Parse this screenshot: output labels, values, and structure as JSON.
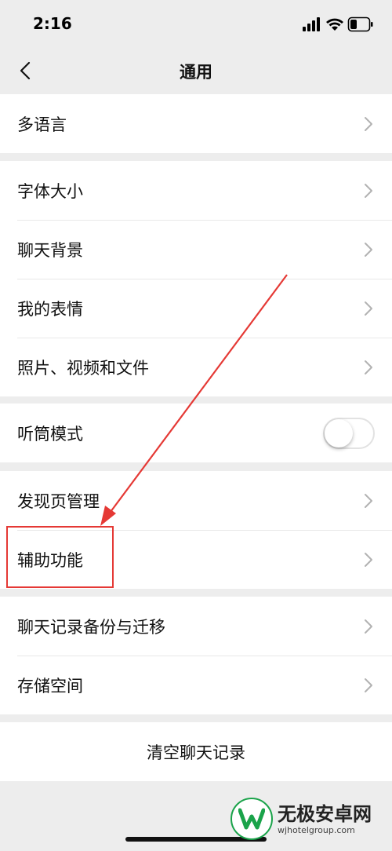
{
  "status_bar": {
    "time": "2:16",
    "icons": [
      "signal-icon",
      "wifi-icon",
      "battery-icon"
    ]
  },
  "nav": {
    "back_icon": "chevron-left-icon",
    "title": "通用"
  },
  "groups": [
    {
      "items": [
        {
          "label": "多语言",
          "accessory": "chevron"
        }
      ]
    },
    {
      "items": [
        {
          "label": "字体大小",
          "accessory": "chevron"
        },
        {
          "label": "聊天背景",
          "accessory": "chevron"
        },
        {
          "label": "我的表情",
          "accessory": "chevron"
        },
        {
          "label": "照片、视频和文件",
          "accessory": "chevron"
        }
      ]
    },
    {
      "items": [
        {
          "label": "听筒模式",
          "accessory": "toggle",
          "toggle_on": false
        }
      ]
    },
    {
      "items": [
        {
          "label": "发现页管理",
          "accessory": "chevron"
        },
        {
          "label": "辅助功能",
          "accessory": "chevron",
          "highlighted": true
        }
      ]
    },
    {
      "items": [
        {
          "label": "聊天记录备份与迁移",
          "accessory": "chevron"
        },
        {
          "label": "存储空间",
          "accessory": "chevron"
        }
      ]
    }
  ],
  "clear_button": {
    "label": "清空聊天记录"
  },
  "annotation": {
    "color": "#e53935"
  },
  "watermark": {
    "name": "无极安卓网",
    "url": "wjhotelgroup.com",
    "color": "#1aa34a"
  }
}
